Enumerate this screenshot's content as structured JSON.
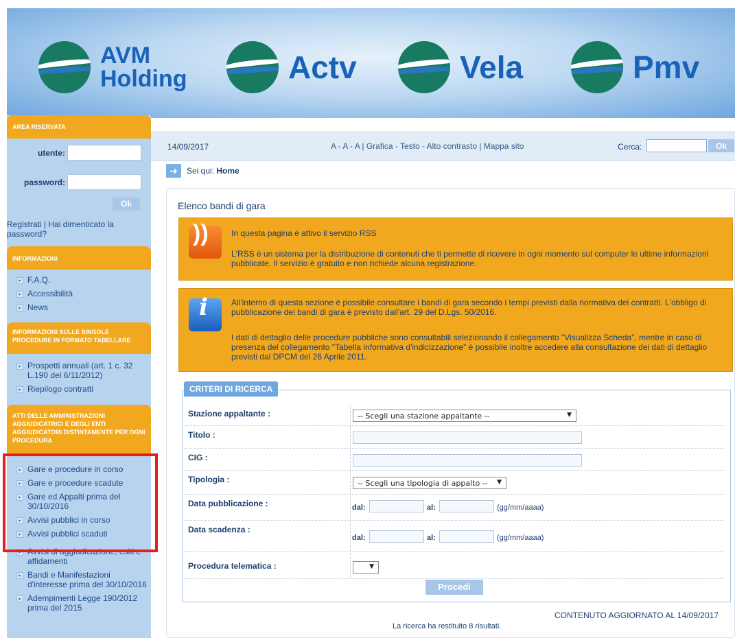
{
  "header": {
    "brands": [
      "AVM Holding",
      "Actv",
      "Vela",
      "Pmv"
    ]
  },
  "sidebar": {
    "reserved_area": {
      "title": "AREA RISERVATA",
      "user_label": "utente:",
      "password_label": "password:",
      "ok_label": "Ok",
      "register_text": "Registrati | Hai dimenticato la password?"
    },
    "info": {
      "title": "INFORMAZIONI",
      "items": [
        "F.A.Q.",
        "Accessibilità",
        "News"
      ]
    },
    "procedures_table": {
      "title": "INFORMAZIONI SULLE SINGOLE PROCEDURE IN FORMATO TABELLARE",
      "items": [
        "Prospetti annuali (art. 1 c. 32 L.190 del 6/11/2012)",
        "Riepilogo contratti"
      ]
    },
    "acts": {
      "title": "ATTI DELLE AMMINISTRAZIONI AGGIUDICATRICI E DEGLI ENTI AGGIUDICATORI DISTINTAMENTE PER OGNI PROCEDURA",
      "items": [
        "Gare e procedure in corso",
        "Gare e procedure scadute",
        "Gare ed Appalti prima del 30/10/2016",
        "Avvisi pubblici in corso",
        "Avvisi pubblici scaduti",
        "Avvisi di aggiudicazione, esiti e affidamenti",
        "Bandi e Manifestazioni d'interesse prima del 30/10/2016",
        "Adempimenti Legge 190/2012 prima del 2015"
      ]
    }
  },
  "topbar": {
    "date": "14/09/2017",
    "links": "A - A - A | Grafica - Testo - Alto contrasto | Mappa sito",
    "search_label": "Cerca:",
    "search_ok": "Ok"
  },
  "breadcrumb": {
    "prefix": "Sei qui:",
    "current": "Home"
  },
  "main": {
    "title": "Elenco bandi di gara",
    "rss_notice": {
      "line1": "In questa pagina è attivo il servizio RSS",
      "line2": "L'RSS è un sistema per la distribuzione di contenuti che ti permette di ricevere in ogni momento sul computer le ultime informazioni pubblicate. Il servizio è gratuito e non richiede alcuna registrazione."
    },
    "info_notice": {
      "para1": "All'interno di questa sezione è possibile consultare i bandi di gara secondo i tempi previsti dalla normativa dei contratti. L'obbligo di pubblicazione dei bandi di gara è previsto dall'art. 29 del D.Lgs. 50/2016.",
      "para2": "I dati di dettaglio delle procedure pubbliche sono consultabili selezionando il collegamento \"Visualizza Scheda\", mentre in caso di presenza del collegamento \"Tabella informativa d'indicizzazione\" è possibile inoltre accedere alla consultazione dei dati di dettaglio previsti dal DPCM del 26 Aprile 2011."
    },
    "criteria": {
      "title": "CRITERI DI RICERCA",
      "station_label": "Stazione appaltante :",
      "station_value": "-- Scegli una stazione appaltante --",
      "title_label": "Titolo :",
      "cig_label": "CIG :",
      "type_label": "Tipologia :",
      "type_value": "-- Scegli una tipologia di appalto --",
      "pub_label": "Data pubblicazione :",
      "exp_label": "Data scadenza :",
      "from_label": "dal:",
      "to_label": "al:",
      "date_hint": "(gg/mm/aaaa)",
      "telematic_label": "Procedura telematica :",
      "telematic_value": "",
      "submit_label": "Procedi"
    },
    "updated": "CONTENUTO AGGIORNATO AL 14/09/2017",
    "results": "La ricerca ha restituito 8 risultati."
  }
}
